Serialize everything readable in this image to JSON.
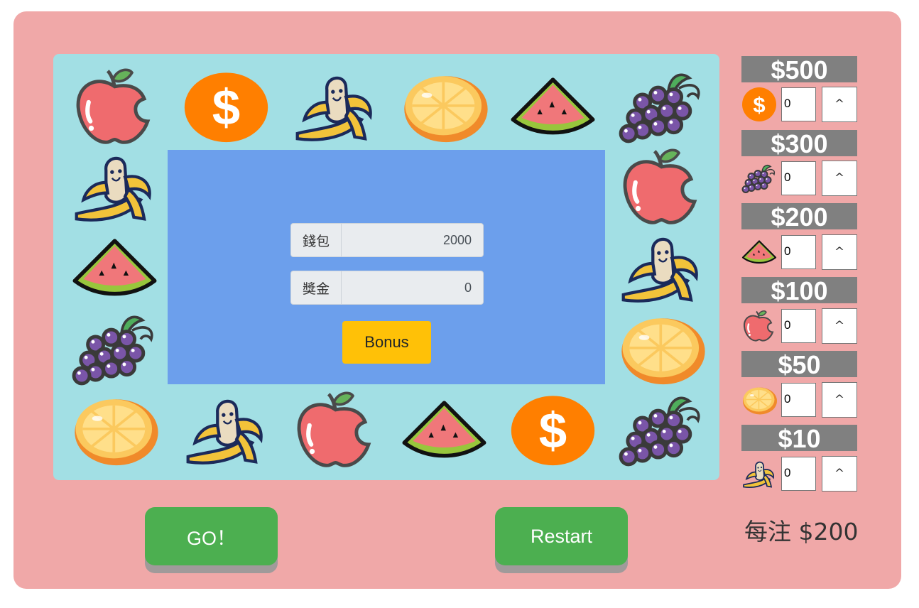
{
  "board": {
    "cells": [
      {
        "icon": "apple-icon"
      },
      {
        "icon": "dollar-icon"
      },
      {
        "icon": "banana-icon"
      },
      {
        "icon": "orange-icon"
      },
      {
        "icon": "watermelon-icon"
      },
      {
        "icon": "grape-icon"
      },
      {
        "icon": "banana-icon"
      },
      {
        "icon": "apple-icon"
      },
      {
        "icon": "watermelon-icon"
      },
      {
        "icon": "banana-icon"
      },
      {
        "icon": "grape-icon"
      },
      {
        "icon": "orange-icon"
      },
      {
        "icon": "orange-icon"
      },
      {
        "icon": "banana-icon"
      },
      {
        "icon": "apple-icon"
      },
      {
        "icon": "watermelon-icon"
      },
      {
        "icon": "dollar-icon"
      },
      {
        "icon": "grape-icon"
      }
    ]
  },
  "wallet": {
    "label": "錢包",
    "value": "2000"
  },
  "prize": {
    "label": "獎金",
    "value": "0"
  },
  "bonus_label": "Bonus",
  "go_label": "GO！",
  "restart_label": "Restart",
  "bets": [
    {
      "price": "$500",
      "icon": "dollar-icon",
      "value": "0",
      "button": "^"
    },
    {
      "price": "$300",
      "icon": "grape-icon",
      "value": "0",
      "button": "^"
    },
    {
      "price": "$200",
      "icon": "watermelon-icon",
      "value": "0",
      "button": "^"
    },
    {
      "price": "$100",
      "icon": "apple-icon",
      "value": "0",
      "button": "^"
    },
    {
      "price": "$50",
      "icon": "orange-icon",
      "value": "0",
      "button": "^"
    },
    {
      "price": "$10",
      "icon": "banana-icon",
      "value": "0",
      "button": "^"
    }
  ],
  "per_bet": "每注 $200",
  "colors": {
    "frame": "#f0a8a8",
    "board": "#a2dfe4",
    "center": "#6c9fec",
    "bonus": "#ffc107",
    "go": "#4caf50"
  }
}
